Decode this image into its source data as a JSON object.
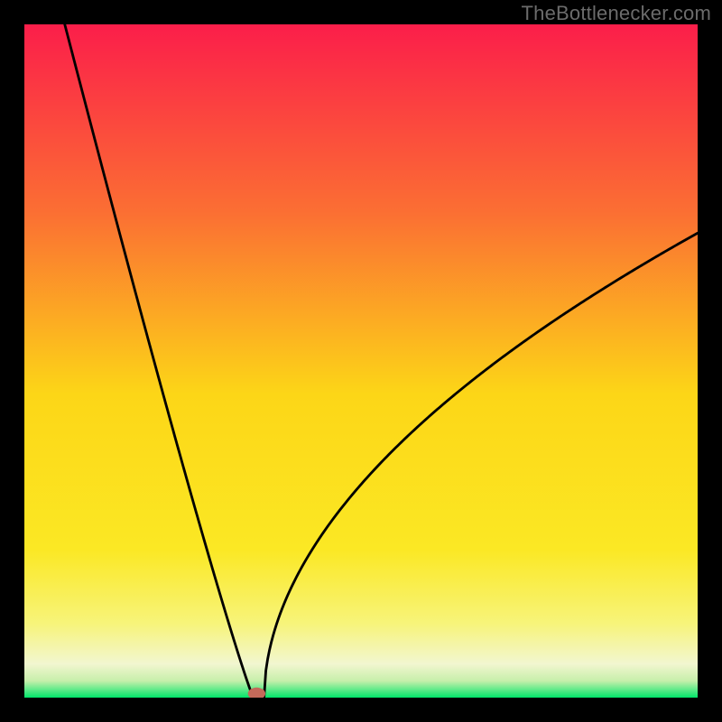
{
  "watermark": "TheBottlenecker.com",
  "chart_data": {
    "type": "line",
    "title": "",
    "xlabel": "",
    "ylabel": "",
    "xlim": [
      0,
      100
    ],
    "ylim": [
      0,
      100
    ],
    "background_gradient": {
      "top": "#fb1e4a",
      "mid_upper": "#fb8c2b",
      "mid": "#fcd617",
      "mid_lower": "#f8f66e",
      "lower": "#f5f8d9",
      "bottom": "#00e66a"
    },
    "curve": {
      "description": "V-shaped bottleneck curve: steep descent from top-left, minimum near x≈34, rising curve toward right",
      "minimum_x": 34,
      "minimum_y": 0,
      "left_start": {
        "x": 6,
        "y": 100
      },
      "right_end": {
        "x": 100,
        "y": 69
      }
    },
    "marker": {
      "x": 34.5,
      "y": 0.5,
      "color": "#c46a5a",
      "rx": 1.3,
      "ry": 0.9
    }
  }
}
